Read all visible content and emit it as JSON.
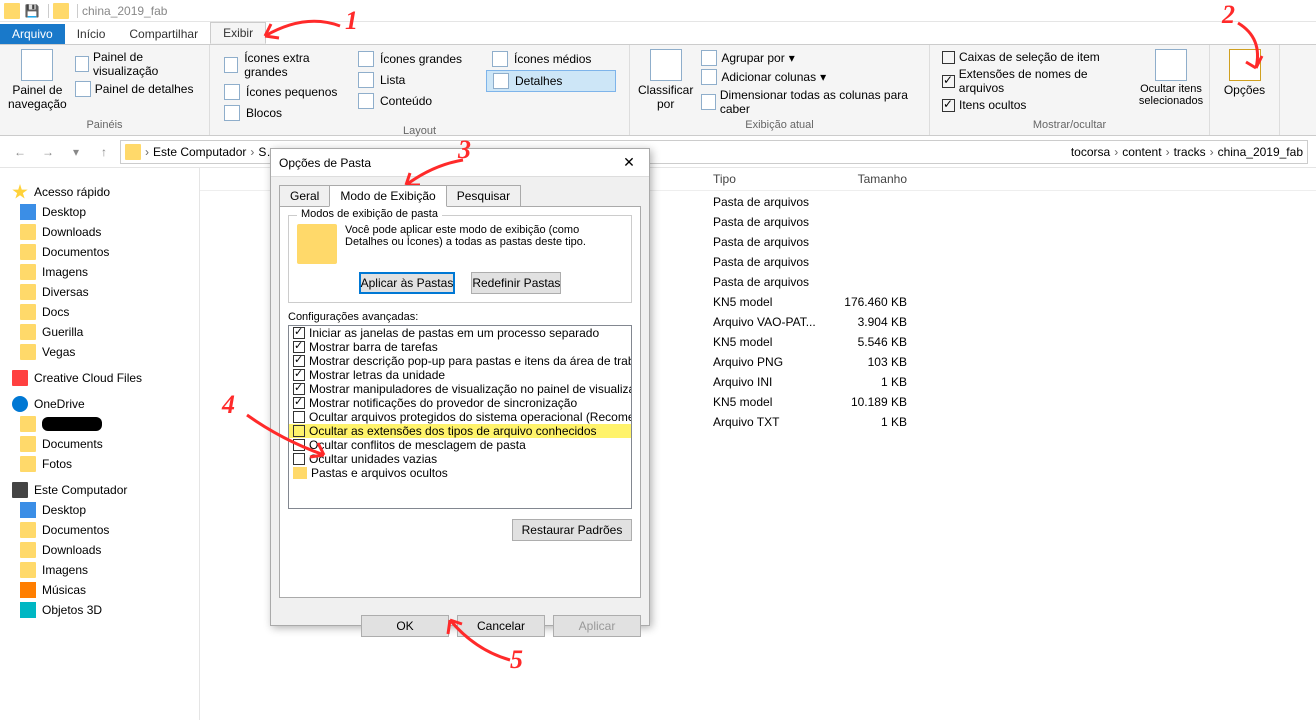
{
  "window": {
    "title": "china_2019_fab"
  },
  "tabs": {
    "file": "Arquivo",
    "home": "Início",
    "share": "Compartilhar",
    "view": "Exibir"
  },
  "ribbon": {
    "panes": {
      "title": "Painéis",
      "nav": "Painel de\nnavegação",
      "preview": "Painel de visualização",
      "details": "Painel de detalhes"
    },
    "layout": {
      "title": "Layout",
      "xl": "Ícones extra grandes",
      "lg": "Ícones grandes",
      "md": "Ícones médios",
      "sm": "Ícones pequenos",
      "list": "Lista",
      "details": "Detalhes",
      "tiles": "Blocos",
      "content": "Conteúdo"
    },
    "current": {
      "title": "Exibição atual",
      "sort": "Classificar\npor",
      "group": "Agrupar por",
      "cols": "Adicionar colunas",
      "fit": "Dimensionar todas as colunas para caber"
    },
    "showhide": {
      "title": "Mostrar/ocultar",
      "chk_boxes": "Caixas de seleção de item",
      "chk_ext": "Extensões de nomes de arquivos",
      "chk_hidden": "Itens ocultos",
      "hide_sel": "Ocultar itens\nselecionados"
    },
    "options": "Opções"
  },
  "breadcrumb": [
    "Este Computador",
    "S…",
    "…",
    "tocorsa",
    "content",
    "tracks",
    "china_2019_fab"
  ],
  "sidebar": {
    "quick": "Acesso rápido",
    "items1": [
      "Desktop",
      "Downloads",
      "Documentos",
      "Imagens",
      "Diversas",
      "Docs",
      "Guerilla",
      "Vegas"
    ],
    "cc": "Creative Cloud Files",
    "onedrive": "OneDrive",
    "od_items": [
      "████████",
      "Documents",
      "Fotos"
    ],
    "pc": "Este Computador",
    "pc_items": [
      "Desktop",
      "Documentos",
      "Downloads",
      "Imagens",
      "Músicas",
      "Objetos 3D"
    ]
  },
  "columns": {
    "type": "Tipo",
    "size": "Tamanho"
  },
  "rows": [
    {
      "type": "Pasta de arquivos",
      "size": ""
    },
    {
      "type": "Pasta de arquivos",
      "size": ""
    },
    {
      "type": "Pasta de arquivos",
      "size": ""
    },
    {
      "type": "Pasta de arquivos",
      "size": ""
    },
    {
      "type": "Pasta de arquivos",
      "size": ""
    },
    {
      "type": "KN5 model",
      "size": "176.460 KB"
    },
    {
      "type": "Arquivo VAO-PAT...",
      "size": "3.904 KB"
    },
    {
      "type": "KN5 model",
      "size": "5.546 KB"
    },
    {
      "type": "Arquivo PNG",
      "size": "103 KB"
    },
    {
      "type": "Arquivo INI",
      "size": "1 KB"
    },
    {
      "type": "KN5 model",
      "size": "10.189 KB"
    },
    {
      "type": "Arquivo TXT",
      "size": "1 KB"
    }
  ],
  "dialog": {
    "title": "Opções de Pasta",
    "tabs": {
      "general": "Geral",
      "view": "Modo de Exibição",
      "search": "Pesquisar"
    },
    "fs_legend": "Modos de exibição de pasta",
    "fs_text": "Você pode aplicar este modo de exibição (como Detalhes ou Ícones) a todas as pastas deste tipo.",
    "btn_apply_folders": "Aplicar às Pastas",
    "btn_reset_folders": "Redefinir Pastas",
    "adv_label": "Configurações avançadas:",
    "adv": [
      {
        "c": true,
        "t": "Iniciar as janelas de pastas em um processo separado"
      },
      {
        "c": true,
        "t": "Mostrar barra de tarefas"
      },
      {
        "c": true,
        "t": "Mostrar descrição pop-up para pastas e itens da área de trabalho"
      },
      {
        "c": true,
        "t": "Mostrar letras da unidade"
      },
      {
        "c": true,
        "t": "Mostrar manipuladores de visualização no painel de visualização"
      },
      {
        "c": true,
        "t": "Mostrar notificações do provedor de sincronização"
      },
      {
        "c": false,
        "t": "Ocultar arquivos protegidos do sistema operacional (Recomendado)"
      },
      {
        "c": false,
        "t": "Ocultar as extensões dos tipos de arquivo conhecidos",
        "hl": true
      },
      {
        "c": false,
        "t": "Ocultar conflitos de mesclagem de pasta"
      },
      {
        "c": false,
        "t": "Ocultar unidades vazias"
      },
      {
        "folder": true,
        "t": "Pastas e arquivos ocultos"
      }
    ],
    "btn_restore": "Restaurar Padrões",
    "btn_ok": "OK",
    "btn_cancel": "Cancelar",
    "btn_apply": "Aplicar"
  },
  "annotations": {
    "n1": "1",
    "n2": "2",
    "n3": "3",
    "n4": "4",
    "n5": "5"
  }
}
